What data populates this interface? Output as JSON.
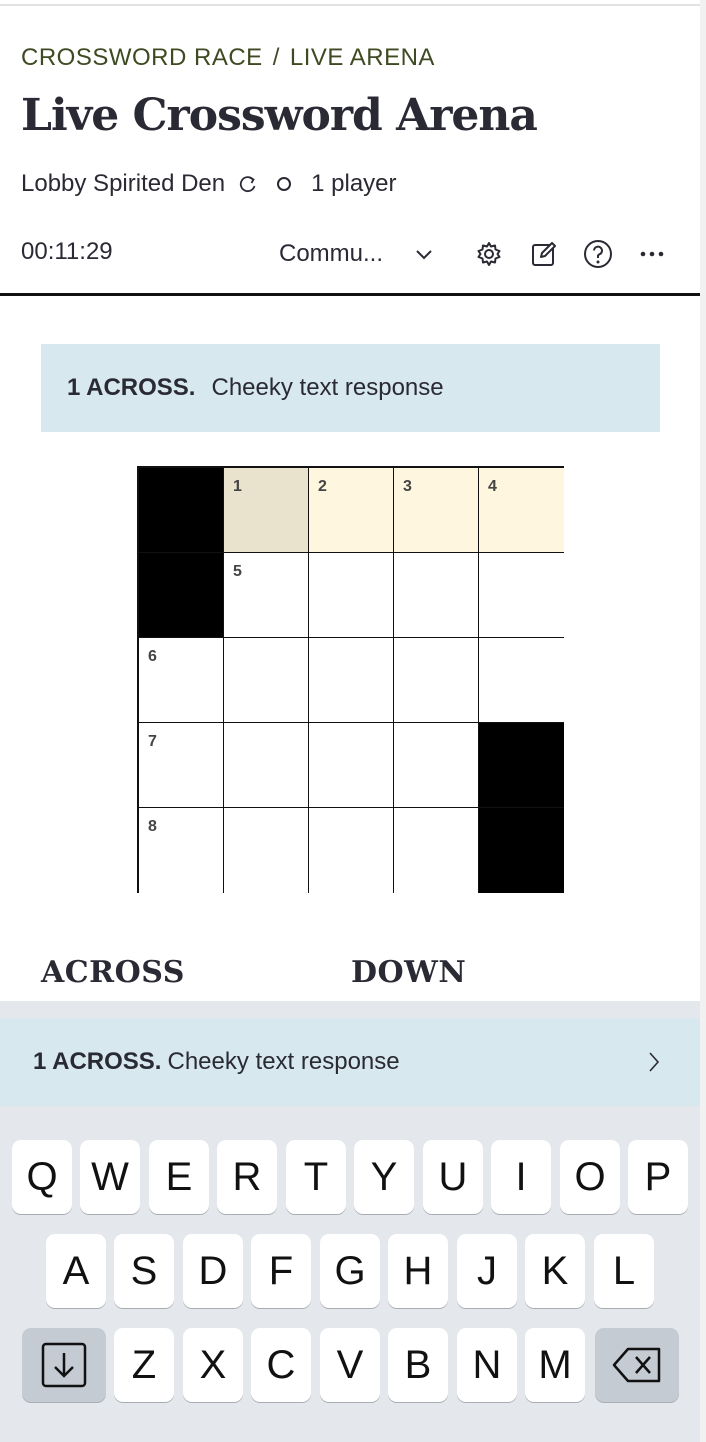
{
  "breadcrumb": {
    "home": "CROSSWORD RACE",
    "separator": "/",
    "current": "LIVE ARENA"
  },
  "title": "Live Crossword Arena",
  "lobby": {
    "name": "Lobby Spirited Den",
    "players": "1 player"
  },
  "toolbar": {
    "timer": "00:11:29",
    "mode": "Commu..."
  },
  "active_clue": {
    "number": "1 ACROSS.",
    "text": "Cheeky text response"
  },
  "grid": {
    "numbers": {
      "r0c1": "1",
      "r0c2": "2",
      "r0c3": "3",
      "r0c4": "4",
      "r1c1": "5",
      "r2c0": "6",
      "r3c0": "7",
      "r4c0": "8"
    }
  },
  "lists": {
    "across": "ACROSS",
    "down": "DOWN"
  },
  "clue_bar": {
    "number": "1 ACROSS.",
    "text": "Cheeky text response",
    "next_icon": "chevron-right-icon"
  },
  "keyboard": {
    "row1": [
      "Q",
      "W",
      "E",
      "R",
      "T",
      "Y",
      "U",
      "I",
      "O",
      "P"
    ],
    "row2": [
      "A",
      "S",
      "D",
      "F",
      "G",
      "H",
      "J",
      "K",
      "L"
    ],
    "row3": [
      "Z",
      "X",
      "C",
      "V",
      "B",
      "N",
      "M"
    ]
  },
  "colors": {
    "accent_green": "#3d4a22",
    "clue_bg": "#d8e8ef",
    "active_cell": "#e9e2cd",
    "word_cell": "#fff6e0"
  }
}
